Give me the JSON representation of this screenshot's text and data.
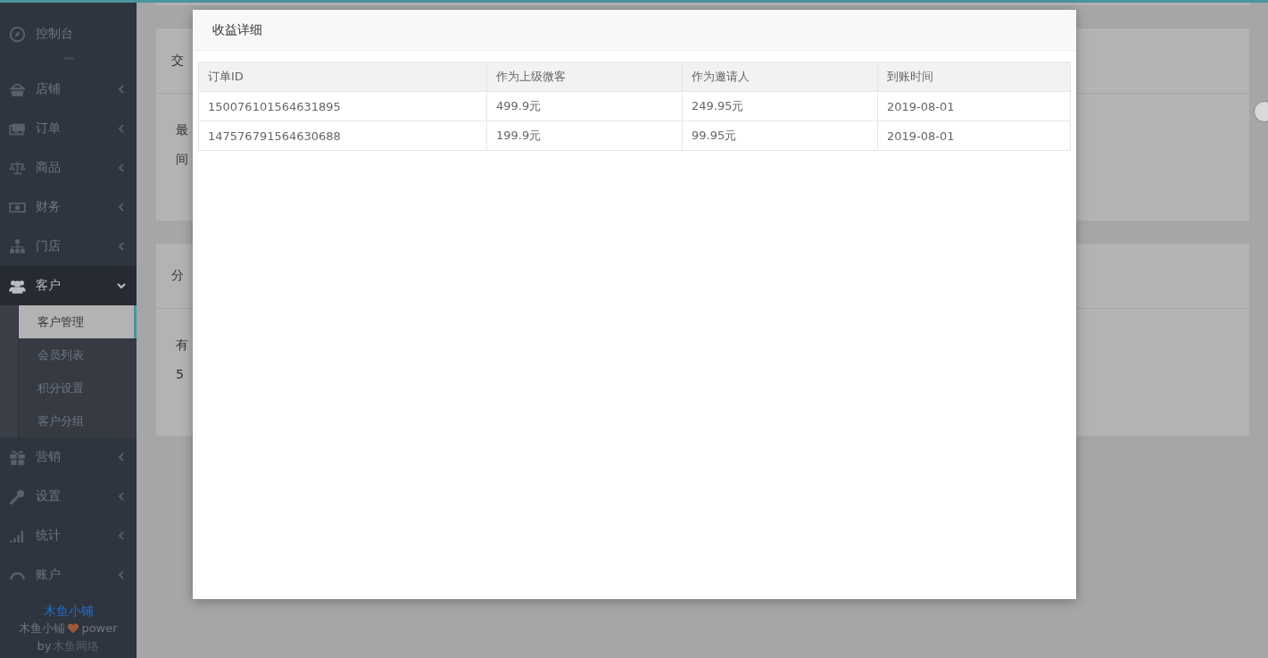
{
  "sidebar": {
    "items": [
      {
        "label": "控制台",
        "kind": "link",
        "expanded": false
      },
      {
        "label": "店铺",
        "kind": "menu",
        "expanded": false
      },
      {
        "label": "订单",
        "kind": "menu",
        "expanded": false
      },
      {
        "label": "商品",
        "kind": "menu",
        "expanded": false
      },
      {
        "label": "财务",
        "kind": "menu",
        "expanded": false
      },
      {
        "label": "门店",
        "kind": "menu",
        "expanded": false
      },
      {
        "label": "客户",
        "kind": "menu",
        "expanded": true,
        "children": [
          {
            "label": "客户管理",
            "selected": true
          },
          {
            "label": "会员列表",
            "selected": false
          },
          {
            "label": "积分设置",
            "selected": false
          },
          {
            "label": "客户分组",
            "selected": false
          }
        ]
      },
      {
        "label": "营销",
        "kind": "menu",
        "expanded": false
      },
      {
        "label": "设置",
        "kind": "menu",
        "expanded": false
      },
      {
        "label": "统计",
        "kind": "menu",
        "expanded": false
      },
      {
        "label": "账户",
        "kind": "menu",
        "expanded": false
      }
    ]
  },
  "footer": {
    "brand": "木鱼小铺",
    "power_name": "木鱼小铺",
    "power_word": "power",
    "by": "by",
    "company": "木鱼网络"
  },
  "panels": [
    {
      "title": "交",
      "lines": [
        "最",
        "间"
      ]
    },
    {
      "title": "分",
      "lines": [
        "有",
        "5"
      ]
    }
  ],
  "modal": {
    "title": "收益详细",
    "table": {
      "columns": [
        "订单ID",
        "作为上级微客",
        "作为邀请人",
        "到账时间"
      ],
      "rows": [
        [
          "150076101564631895",
          "499.9元",
          "249.95元",
          "2019-08-01"
        ],
        [
          "147576791564630688",
          "199.9元",
          "99.95元",
          "2019-08-01"
        ]
      ]
    }
  }
}
